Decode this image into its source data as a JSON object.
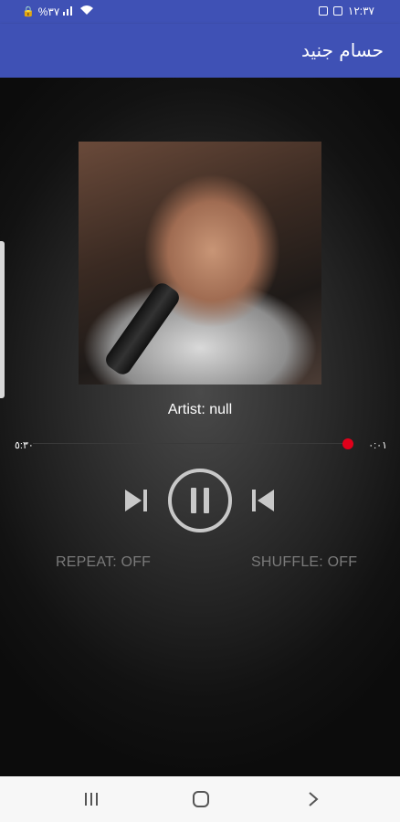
{
  "status_bar": {
    "left_text": "%٣٧",
    "right_time": "١٢:٣٧",
    "icons": [
      "lock-icon",
      "signal-icon",
      "wifi-icon",
      "notification-icon",
      "gallery-icon"
    ]
  },
  "app_bar": {
    "title": "حسام جنيد",
    "color": "#3f51b5"
  },
  "player": {
    "cover_icon": "album-cover-image",
    "artist_label": "Artist: null",
    "elapsed_time": "٠:٠١",
    "total_time": "٥:٣٠",
    "progress": 0.01,
    "accent_color": "#e0001a",
    "controls": {
      "next_icon": "skip-next-icon",
      "play_icon": "pause-icon",
      "prev_icon": "skip-previous-icon"
    },
    "repeat_label": "REPEAT: OFF",
    "shuffle_label": "SHUFFLE: OFF"
  },
  "nav_bar": {
    "icons": [
      "recents-icon",
      "home-icon",
      "back-icon"
    ]
  }
}
